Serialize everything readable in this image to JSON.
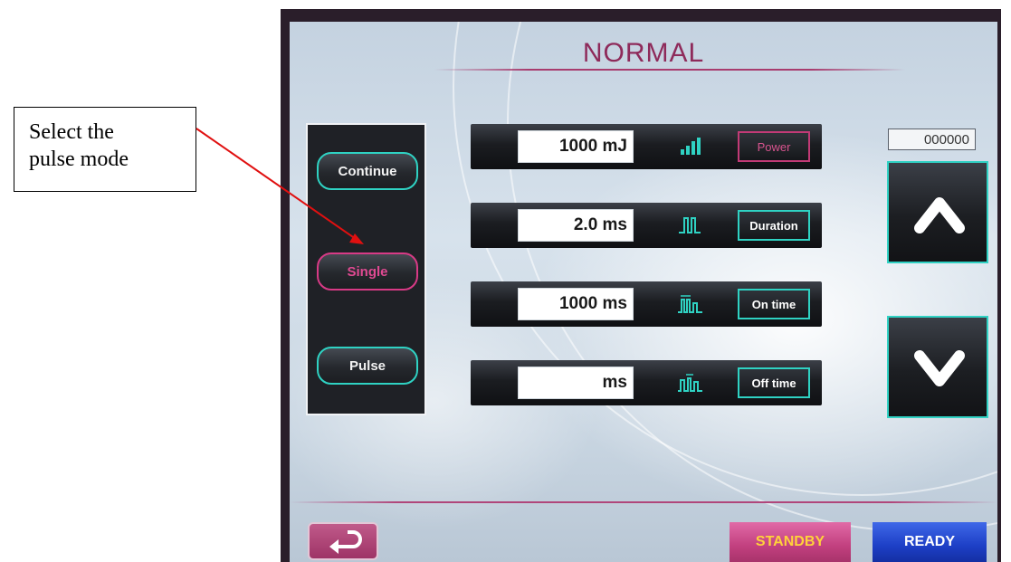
{
  "annotation": {
    "callout_line1": "Select the",
    "callout_line2": "pulse mode"
  },
  "screen": {
    "title": "NORMAL",
    "modes": [
      {
        "label": "Continue",
        "active": false
      },
      {
        "label": "Single",
        "active": true
      },
      {
        "label": "Pulse",
        "active": false
      }
    ],
    "params": [
      {
        "value": "1000  mJ",
        "icon": "signal-bars-icon",
        "label": "Power"
      },
      {
        "value": "2.0 ms",
        "icon": "pulse-wave-icon",
        "label": "Duration"
      },
      {
        "value": "1000  ms",
        "icon": "on-time-wave-icon",
        "label": "On time"
      },
      {
        "value": "ms",
        "icon": "off-time-wave-icon",
        "label": "Off time"
      }
    ],
    "counter": "000000",
    "up_icon": "chevron-up-icon",
    "down_icon": "chevron-down-icon",
    "back_icon": "return-arrow-icon",
    "standby_label": "STANDBY",
    "ready_label": "READY"
  },
  "colors": {
    "accent_teal": "#2fd2c3",
    "accent_magenta": "#d83a86",
    "title": "#8e2a5a",
    "standby_text": "#ffd23a",
    "ready_bg": "#1d3fc6",
    "annotation_arrow": "#e01010"
  }
}
